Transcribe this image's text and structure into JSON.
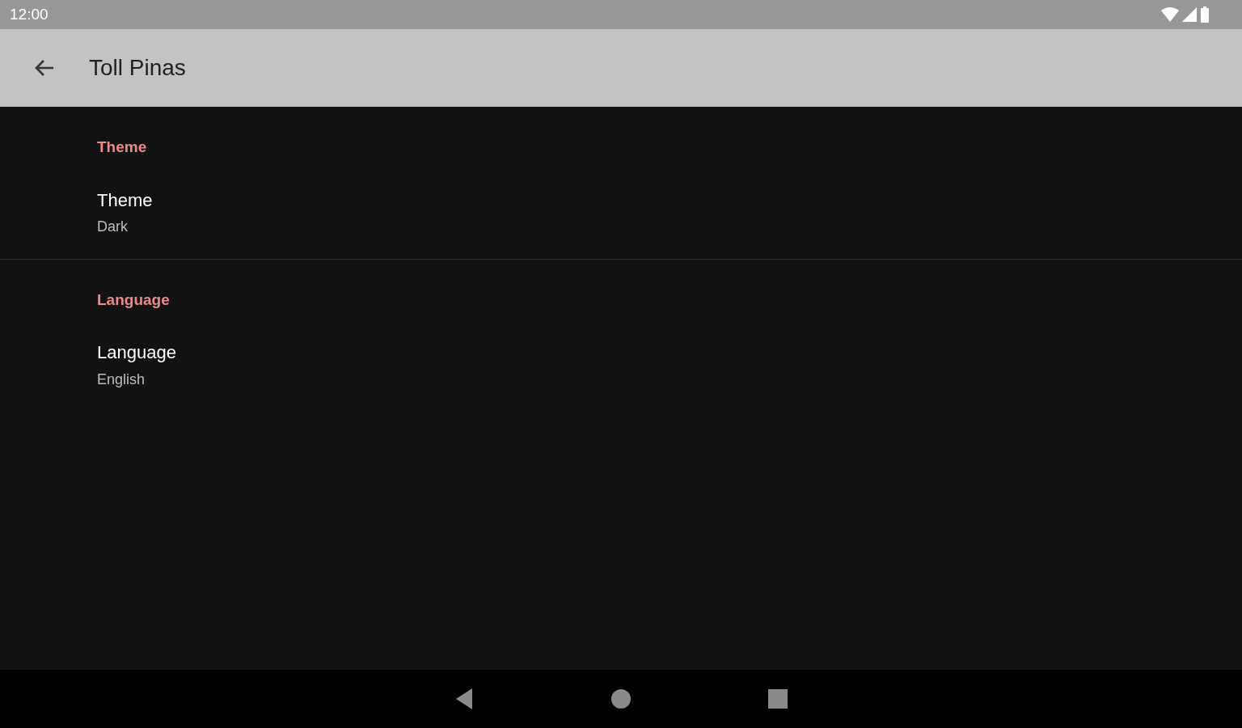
{
  "status_bar": {
    "time": "12:00"
  },
  "app_bar": {
    "title": "Toll Pinas"
  },
  "sections": [
    {
      "header": "Theme",
      "items": [
        {
          "title": "Theme",
          "summary": "Dark"
        }
      ]
    },
    {
      "header": "Language",
      "items": [
        {
          "title": "Language",
          "summary": "English"
        }
      ]
    }
  ]
}
